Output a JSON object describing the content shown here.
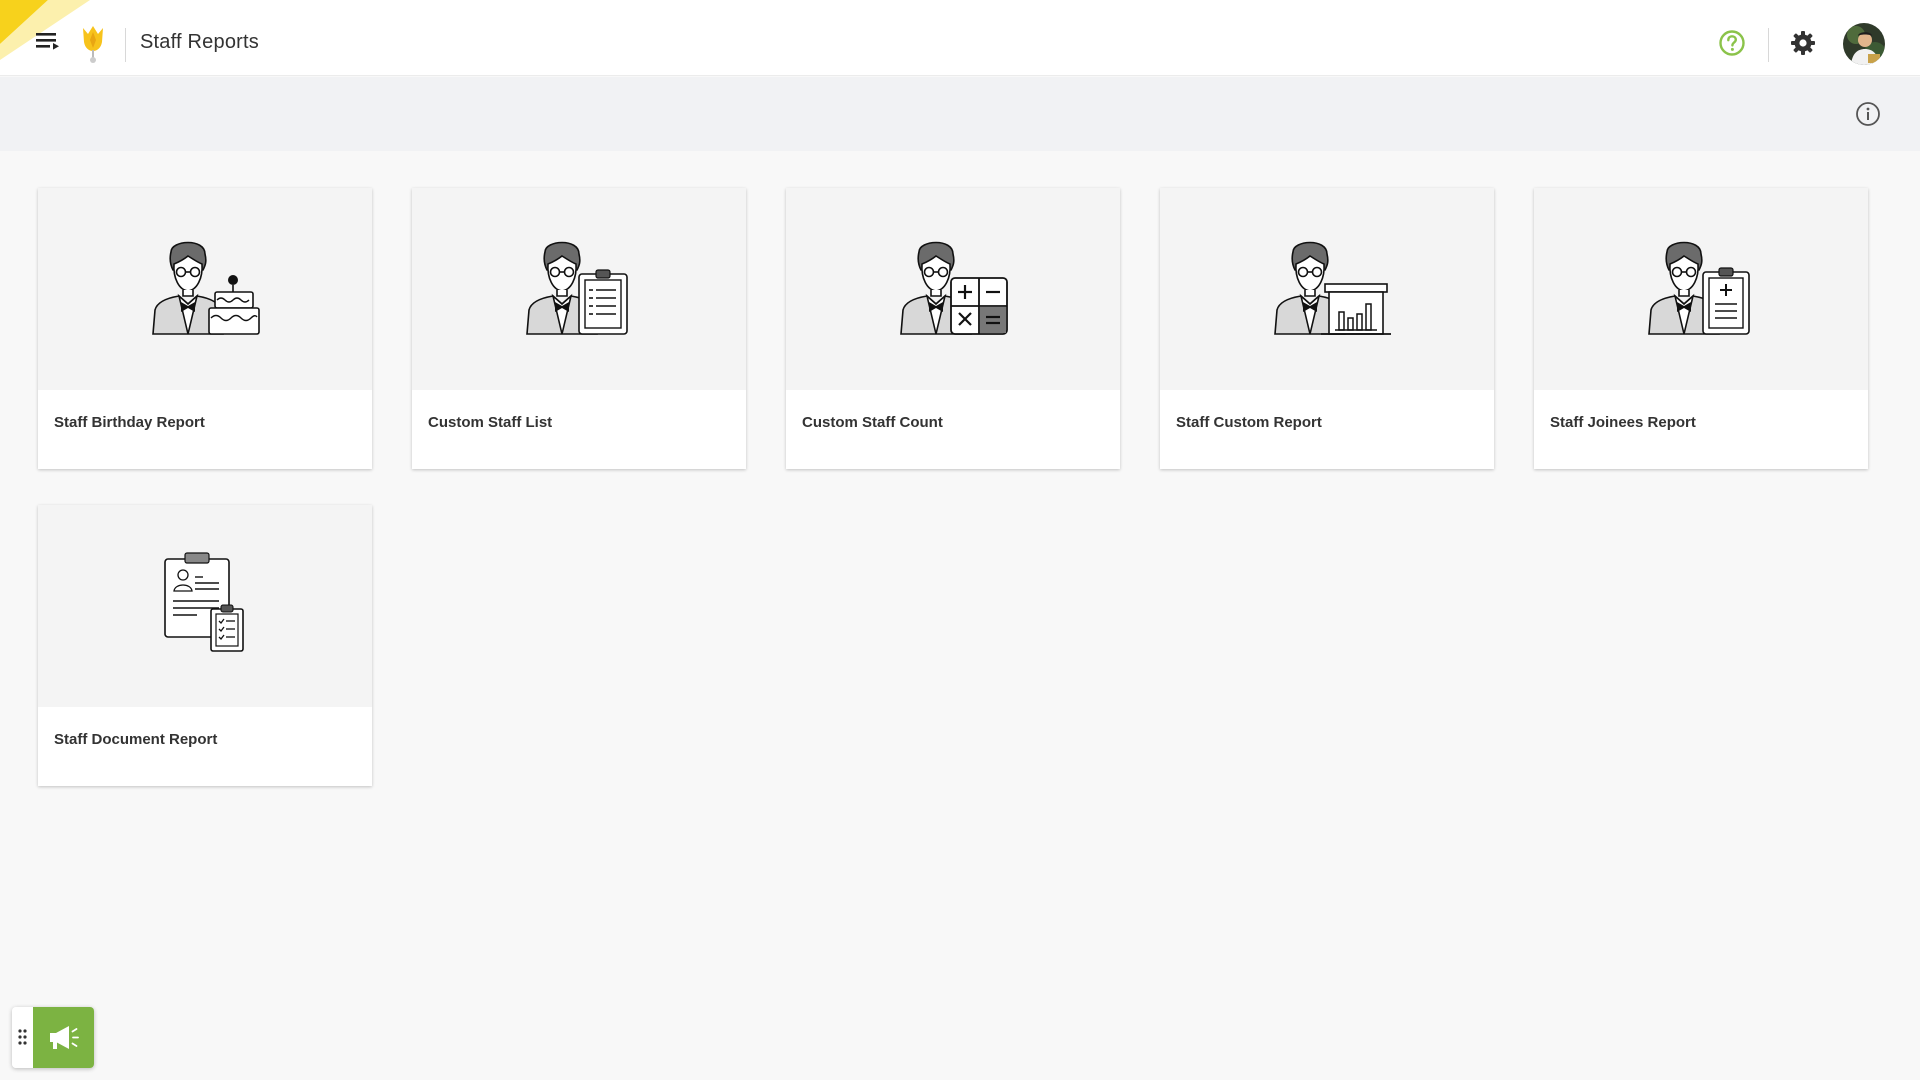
{
  "header": {
    "title": "Staff Reports",
    "icons": {
      "menu": "menu-icon",
      "logo": "tulip-logo",
      "help": "help-circle-icon",
      "settings": "gear-icon",
      "avatar": "user-avatar"
    }
  },
  "subbar": {
    "info_icon": "info-icon"
  },
  "cards": [
    {
      "label": "Staff Birthday Report",
      "icon": "staff-birthday-icon"
    },
    {
      "label": "Custom Staff List",
      "icon": "staff-list-icon"
    },
    {
      "label": "Custom Staff Count",
      "icon": "staff-count-icon"
    },
    {
      "label": "Staff Custom Report",
      "icon": "staff-chart-icon"
    },
    {
      "label": "Staff Joinees Report",
      "icon": "staff-joinees-icon"
    },
    {
      "label": "Staff Document Report",
      "icon": "staff-document-icon"
    }
  ],
  "widget": {
    "icon": "megaphone-icon",
    "handle_icon": "drag-handle-icon"
  },
  "colors": {
    "accent_yellow": "#f7d21c",
    "help_green": "#8bc34a",
    "widget_green": "#7cb342",
    "card_bg": "#f4f4f4",
    "page_bg": "#f8f8f8"
  }
}
